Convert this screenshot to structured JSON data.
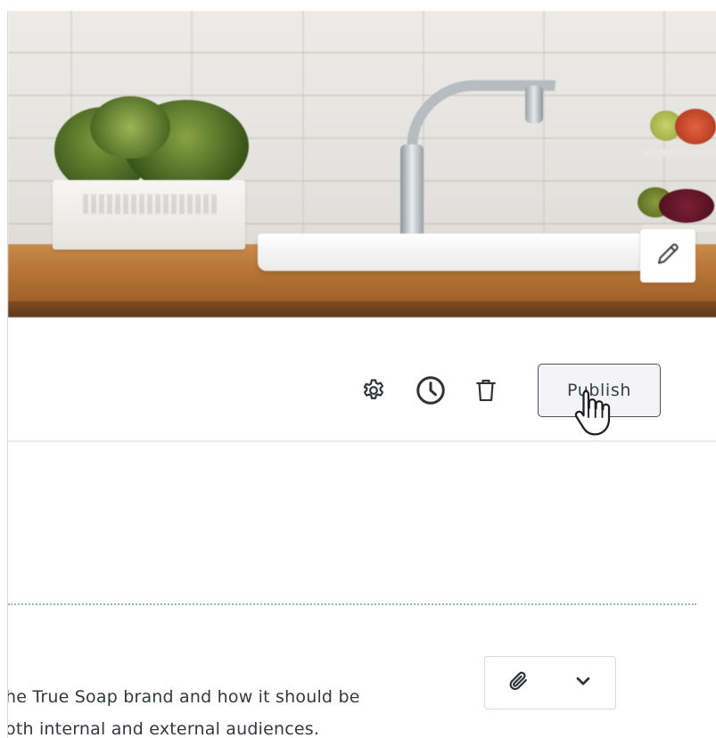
{
  "toolbar": {
    "publish_label": "Publish",
    "icons": [
      "gear-icon",
      "clock-icon",
      "trash-icon"
    ]
  },
  "hero": {
    "edit_icon": "pencil-icon"
  },
  "content": {
    "text_lines": [
      "he True Soap brand and how it should be",
      "oth internal and external audiences."
    ],
    "attach_icon": "paperclip-icon",
    "dropdown_icon": "chevron-down-icon"
  },
  "colors": {
    "text": "#34393f",
    "button_border": "#4f5157",
    "divider": "#9eb4c8",
    "counter_wood": "#b87535"
  }
}
